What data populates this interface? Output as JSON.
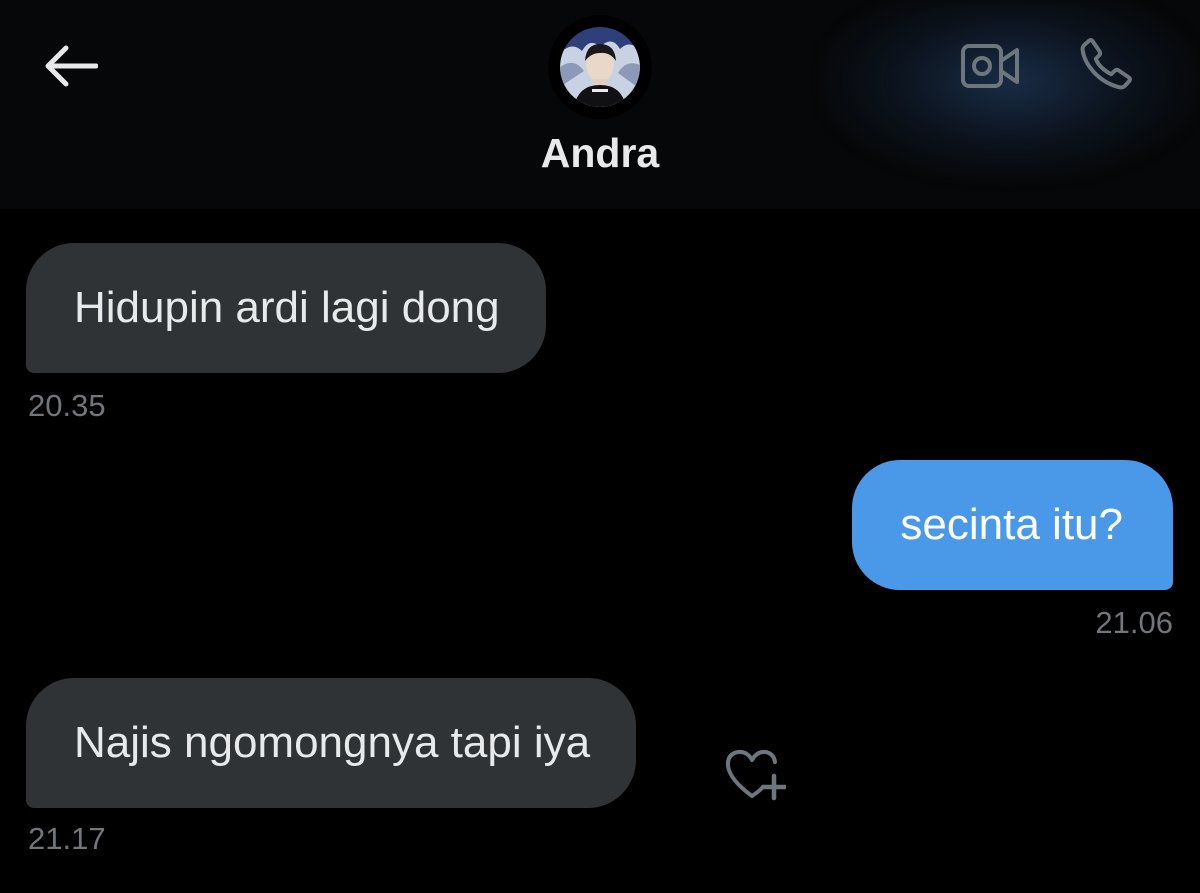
{
  "header": {
    "contact_name": "Andra",
    "back_icon": "arrow-left-icon",
    "video_icon": "video-camera-icon",
    "call_icon": "phone-icon"
  },
  "colors": {
    "background": "#000000",
    "received_bubble": "#2f3336",
    "sent_bubble": "#4a99e9",
    "timestamp": "#71767b",
    "text": "#e7e9ea"
  },
  "messages": [
    {
      "direction": "received",
      "text": "Hidupin ardi lagi dong",
      "time": "20.35"
    },
    {
      "direction": "sent",
      "text": "secinta itu?",
      "time": "21.06"
    },
    {
      "direction": "received",
      "text": "Najis ngomongnya tapi iya",
      "time": "21.17"
    }
  ],
  "reaction": {
    "icon": "heart-plus-icon"
  }
}
